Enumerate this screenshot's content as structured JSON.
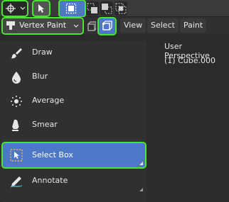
{
  "header": {
    "mode_label": "Vertex Paint",
    "menus": [
      "View",
      "Select",
      "Paint"
    ]
  },
  "tools": [
    {
      "label": "Draw",
      "icon": "brush-icon"
    },
    {
      "label": "Blur",
      "icon": "drop-icon"
    },
    {
      "label": "Average",
      "icon": "average-dots-icon"
    },
    {
      "label": "Smear",
      "icon": "smear-finger-icon"
    },
    {
      "label": "Select Box",
      "icon": "select-box-icon",
      "active": true
    },
    {
      "label": "Annotate",
      "icon": "pencil-annotate-icon"
    }
  ],
  "viewport": {
    "perspective": "User Perspective",
    "object": "(1) Cube.000"
  },
  "colors": {
    "highlight": "#4ae334",
    "active_tool": "#4d78c8",
    "panel_bg": "#303030",
    "header_bg": "#3a3a3a"
  }
}
